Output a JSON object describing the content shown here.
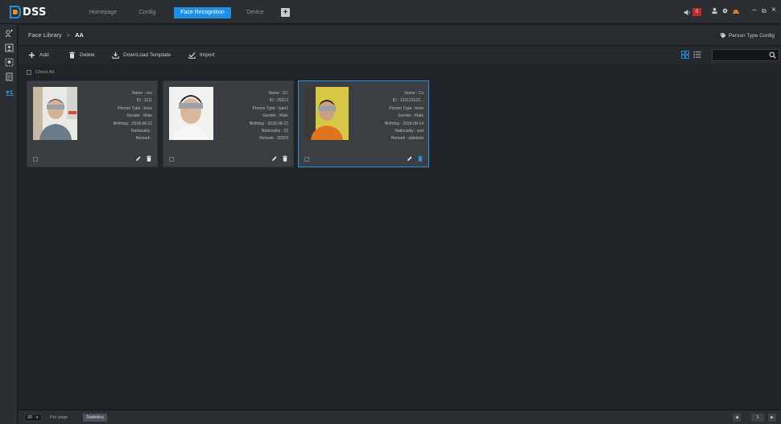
{
  "app": {
    "logo_text": "DSS"
  },
  "nav": {
    "tabs": [
      {
        "label": "Homepage"
      },
      {
        "label": "Config"
      },
      {
        "label": "Face Recognition",
        "active": true
      },
      {
        "label": "Device"
      }
    ],
    "add_label": "+"
  },
  "topright": {
    "alarm_count": "0",
    "minimize": "−",
    "restore": "⧉",
    "close": "×"
  },
  "breadcrumb": {
    "parent": "Face Library",
    "separator": ">",
    "current": "AA"
  },
  "person_type_config": "Person Type Config",
  "toolbar": {
    "add": "Add",
    "delete": "Delete",
    "download": "DownLoad Template",
    "import": "Import",
    "search_placeholder": ""
  },
  "check_all": "Check All",
  "cards": [
    {
      "name": "Name : zsx",
      "id": "ID : 1111",
      "person_type": "Person Type : boss",
      "gender": "Gender : Male",
      "birthday": "Birthday : 2018-08-22",
      "nationality": "Nationality :",
      "remark": "Remark :",
      "selected": false
    },
    {
      "name": "Name : SC",
      "id": "ID : 25213",
      "person_type": "Person Type : type1",
      "gender": "Gender : Male",
      "birthday": "Birthday : 2018-08-22",
      "nationality": "Nationality : 23",
      "remark": "Remark : 32323",
      "selected": false
    },
    {
      "name": "Name : Cx",
      "id": "ID : 123123123...",
      "person_type": "Person Type : boss",
      "gender": "Gender : Male",
      "birthday": "Birthday : 2018-08-14",
      "nationality": "Nationality : asd",
      "remark": "Remark : sdsdsda",
      "selected": true
    }
  ],
  "footer": {
    "per_page_value": "20",
    "per_page_label": "Per page",
    "statistics": "Statistics",
    "prev": "◀",
    "page": "1",
    "next": "▶"
  },
  "colors": {
    "accent": "#1d8fe8",
    "background": "#202328",
    "card": "#3a3e43",
    "alarm": "#c0282b"
  }
}
